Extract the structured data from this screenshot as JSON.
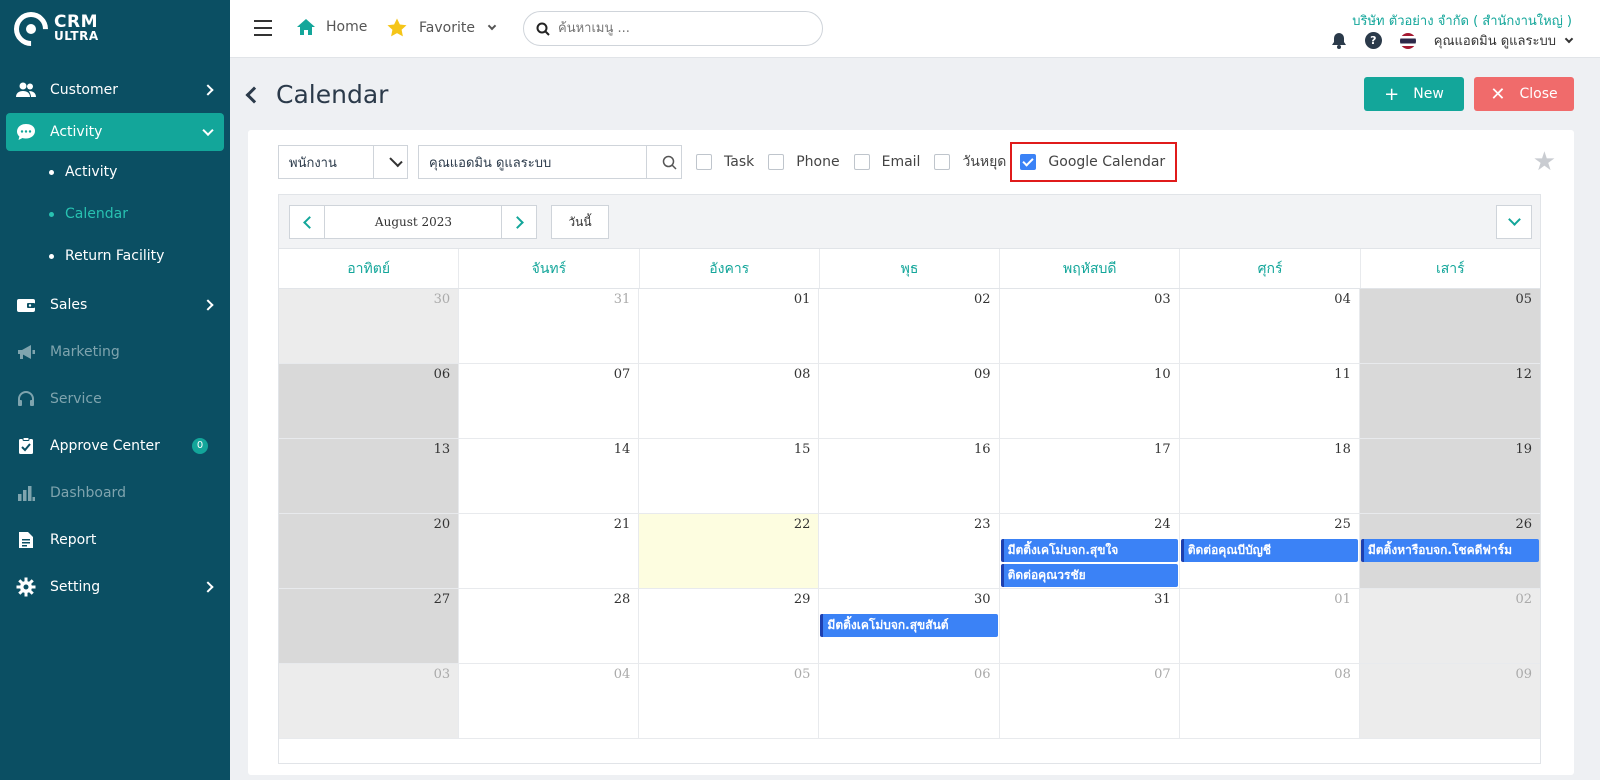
{
  "brand": {
    "line1": "CRM",
    "line2": "ULTRA"
  },
  "sidebar": {
    "items": [
      {
        "label": "Customer"
      },
      {
        "label": "Activity"
      },
      {
        "label": "Sales"
      },
      {
        "label": "Marketing"
      },
      {
        "label": "Service"
      },
      {
        "label": "Approve Center",
        "badge": "0"
      },
      {
        "label": "Dashboard"
      },
      {
        "label": "Report"
      },
      {
        "label": "Setting"
      }
    ],
    "sub": [
      "Activity",
      "Calendar",
      "Return Facility"
    ]
  },
  "topbar": {
    "home": "Home",
    "favorite": "Favorite",
    "search_placeholder": "ค้นหาเมนู ...",
    "company": "บริษัท ตัวอย่าง จำกัด ( สำนักงานใหญ่ )",
    "user": "คุณแอดมิน ดูแลระบบ"
  },
  "page": {
    "title": "Calendar",
    "new_label": "New",
    "close_label": "Close"
  },
  "filter": {
    "type": "พนักงาน",
    "user": "คุณแอดมิน ดูแลระบบ",
    "checks": [
      {
        "label": "Task",
        "checked": false
      },
      {
        "label": "Phone",
        "checked": false
      },
      {
        "label": "Email",
        "checked": false
      },
      {
        "label": "วันหยุด",
        "checked": false
      },
      {
        "label": "Google Calendar",
        "checked": true
      }
    ]
  },
  "calendar": {
    "month_label": "August 2023",
    "today_label": "วันนี้",
    "weekdays": [
      "อาทิตย์",
      "จันทร์",
      "อังคาร",
      "พุธ",
      "พฤหัสบดี",
      "ศุกร์",
      "เสาร์"
    ],
    "days": [
      "30",
      "31",
      "01",
      "02",
      "03",
      "04",
      "05",
      "06",
      "07",
      "08",
      "09",
      "10",
      "11",
      "12",
      "13",
      "14",
      "15",
      "16",
      "17",
      "18",
      "19",
      "20",
      "21",
      "22",
      "23",
      "24",
      "25",
      "26",
      "27",
      "28",
      "29",
      "30",
      "31",
      "01",
      "02",
      "03",
      "04",
      "05",
      "06",
      "07",
      "08",
      "09"
    ],
    "other_month": [
      0,
      1,
      33,
      34,
      35,
      36,
      37,
      38,
      39,
      40,
      41
    ],
    "today_index": 23,
    "events": [
      {
        "day": 25,
        "slot": 0,
        "title": "มีตติ้งเคโม่บจก.สุขใจ"
      },
      {
        "day": 25,
        "slot": 1,
        "title": "ติดต่อคุณวรชัย"
      },
      {
        "day": 26,
        "slot": 0,
        "title": "ติดต่อคุณบีบัญชี"
      },
      {
        "day": 27,
        "slot": 0,
        "title": "มีตติ้งหารือบจก.โชคดีฟาร์ม"
      },
      {
        "day": 31,
        "slot": 0,
        "title": "มีตติ้งเคโม่บจก.สุขสันต์"
      }
    ]
  },
  "colors": {
    "sidebar": "#0b4f63",
    "accent": "#13a69a",
    "event": "#3b82f6",
    "close": "#f06b6b"
  }
}
